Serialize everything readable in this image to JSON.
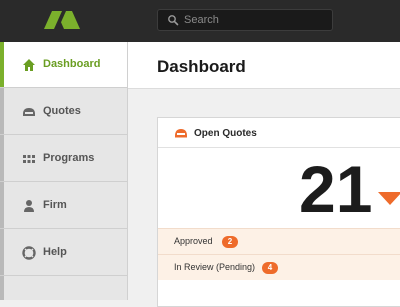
{
  "colors": {
    "accent_green": "#7bb02c",
    "accent_orange": "#ee6b2b",
    "topbar": "#2a2a2a"
  },
  "header": {
    "logo_icon": "logo-icon",
    "search": {
      "placeholder": "Search",
      "value": "",
      "icon": "search-icon"
    }
  },
  "sidebar": {
    "items": [
      {
        "label": "Dashboard",
        "icon": "home-icon",
        "active": true
      },
      {
        "label": "Quotes",
        "icon": "quotes-icon",
        "active": false
      },
      {
        "label": "Programs",
        "icon": "grid-icon",
        "active": false
      },
      {
        "label": "Firm",
        "icon": "person-icon",
        "active": false
      },
      {
        "label": "Help",
        "icon": "lifebuoy-icon",
        "active": false
      }
    ]
  },
  "main": {
    "page_title": "Dashboard",
    "open_quotes": {
      "title": "Open Quotes",
      "icon": "quotes-icon",
      "count": "21",
      "trend": "down",
      "rows": [
        {
          "label": "Approved",
          "badge": "2"
        },
        {
          "label": "In Review (Pending)",
          "badge": "4"
        }
      ]
    }
  }
}
